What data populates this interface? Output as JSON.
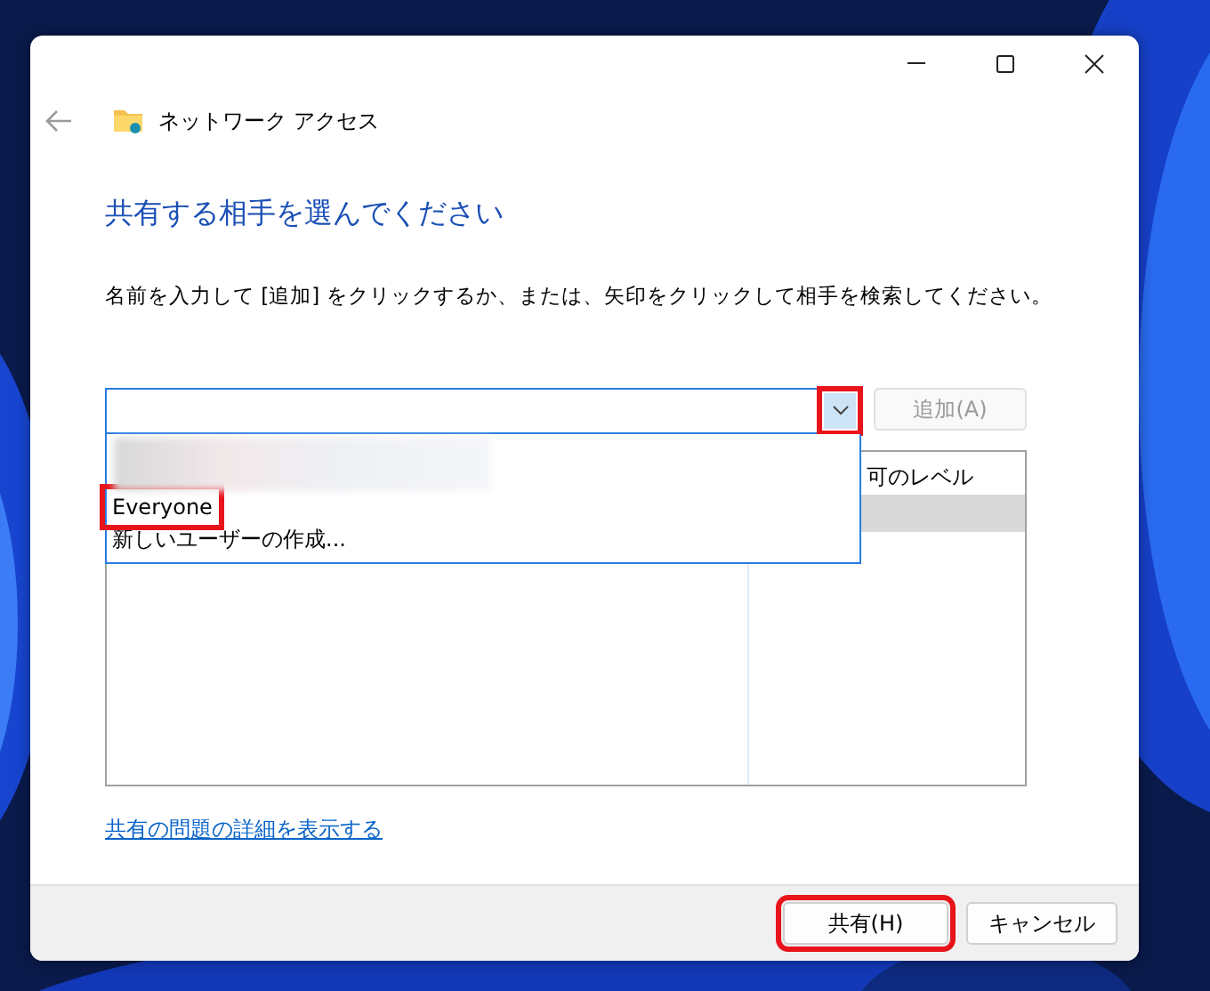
{
  "window": {
    "title": "ネットワーク アクセス"
  },
  "heading": "共有する相手を選んでください",
  "instruction": "名前を入力して [追加] をクリックするか、または、矢印をクリックして相手を検索してください。",
  "combo": {
    "expanded": true,
    "arrow_highlighted": true
  },
  "dropdown_items": [
    {
      "kind": "blurred",
      "highlighted": false
    },
    {
      "kind": "text",
      "label": "Everyone",
      "highlighted": true
    },
    {
      "kind": "text",
      "label": "新しいユーザーの作成...",
      "highlighted": false
    }
  ],
  "add_button": {
    "label": "追加(A)",
    "disabled": true
  },
  "list": {
    "column_2": "可のレベル",
    "rows": [
      {
        "selected": true
      }
    ]
  },
  "link": "共有の問題の詳細を表示する",
  "buttons": [
    {
      "label": "共有(H)",
      "highlighted": true
    },
    {
      "label": "キャンセル",
      "highlighted": false
    }
  ]
}
